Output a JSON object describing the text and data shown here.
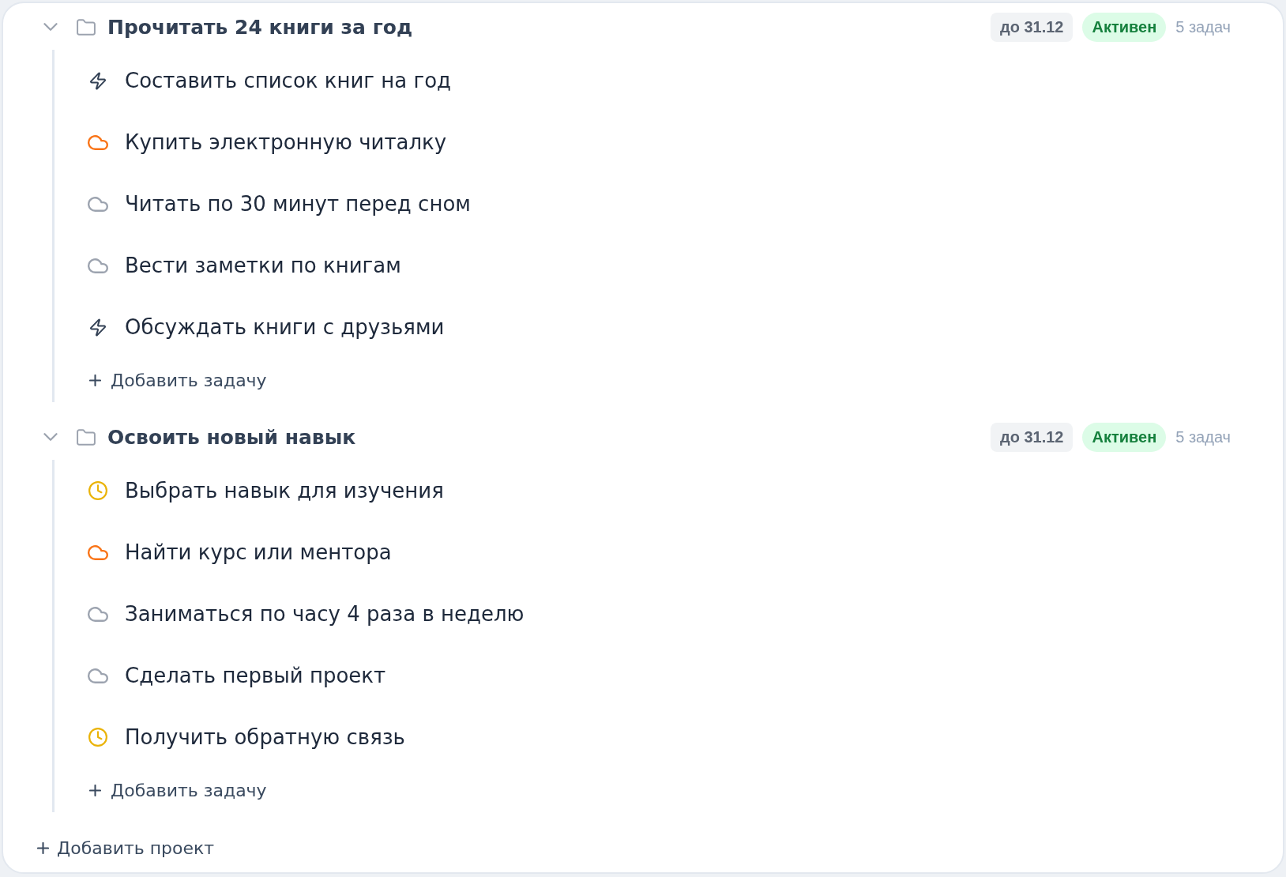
{
  "projects": [
    {
      "title": "Прочитать 24 книги за год",
      "expanded": true,
      "deadline": "до 31.12",
      "status": "Активен",
      "task_count": "5 задач",
      "tasks": [
        {
          "kind": "bolt",
          "color": "#334155",
          "title": "Составить список книг на год"
        },
        {
          "kind": "cloud",
          "color": "#f97316",
          "title": "Купить электронную читалку"
        },
        {
          "kind": "cloud",
          "color": "#9ca3af",
          "title": "Читать по 30 минут перед сном"
        },
        {
          "kind": "cloud",
          "color": "#9ca3af",
          "title": "Вести заметки по книгам"
        },
        {
          "kind": "bolt",
          "color": "#334155",
          "title": "Обсуждать книги с друзьями"
        }
      ],
      "add_task_button": "Добавить задачу"
    },
    {
      "title": "Освоить новый навык",
      "expanded": true,
      "deadline": "до 31.12",
      "status": "Активен",
      "task_count": "5 задач",
      "tasks": [
        {
          "kind": "clock",
          "color": "#eab308",
          "title": "Выбрать навык для изучения"
        },
        {
          "kind": "cloud",
          "color": "#f97316",
          "title": "Найти курс или ментора"
        },
        {
          "kind": "cloud",
          "color": "#9ca3af",
          "title": "Заниматься по часу 4 раза в неделю"
        },
        {
          "kind": "cloud",
          "color": "#9ca3af",
          "title": "Сделать первый проект"
        },
        {
          "kind": "clock",
          "color": "#eab308",
          "title": "Получить обратную связь"
        }
      ],
      "add_task_button": "Добавить задачу"
    }
  ],
  "add_project_button": "Добавить проект"
}
